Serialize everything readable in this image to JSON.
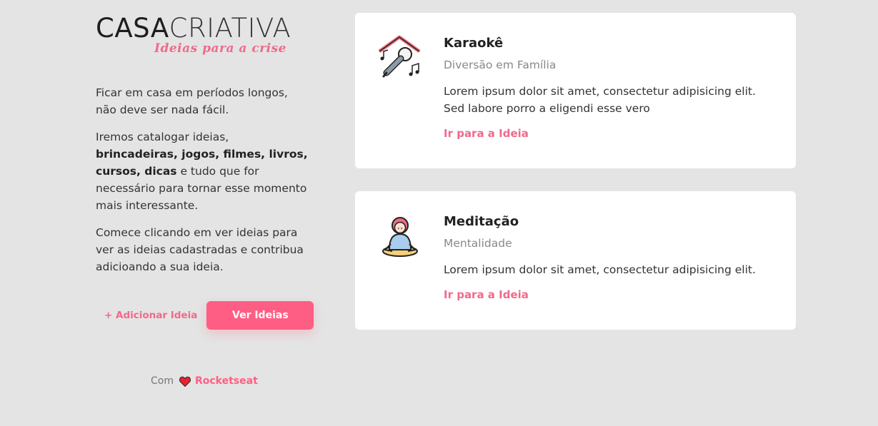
{
  "logo": {
    "casa": "CASA",
    "criativa": "CRIATIVA",
    "tagline": "Ideias para a crise"
  },
  "intro": {
    "p1": "Ficar em casa em períodos longos, não deve ser nada fácil.",
    "p2_start": "Iremos catalogar ideias, ",
    "p2_bold": "brincadeiras, jogos, filmes, livros, cursos, dicas",
    "p2_end": " e tudo que for necessário para tornar esse momento mais interessante.",
    "p3": "Comece clicando em ver ideias para ver as ideias cadastradas e contribua adicioando a sua ideia."
  },
  "actions": {
    "add_label": "+ Adicionar Ideia",
    "view_label": "Ver Ideias"
  },
  "footer": {
    "prefix": "Com",
    "brand": "Rocketseat"
  },
  "ideas": [
    {
      "icon": "karaoke-icon",
      "title": "Karaokê",
      "category": "Diversão em Família",
      "description": "Lorem ipsum dolor sit amet, consectetur adipisicing elit. Sed labore porro a eligendi esse vero",
      "link": "Ir para a Ideia"
    },
    {
      "icon": "meditation-icon",
      "title": "Meditação",
      "category": "Mentalidade",
      "description": "Lorem ipsum dolor sit amet, consectetur adipisicing elit.",
      "link": "Ir para a Ideia"
    }
  ],
  "colors": {
    "accent": "#ff5e84",
    "background": "#e4e4e4",
    "card": "#ffffff"
  }
}
